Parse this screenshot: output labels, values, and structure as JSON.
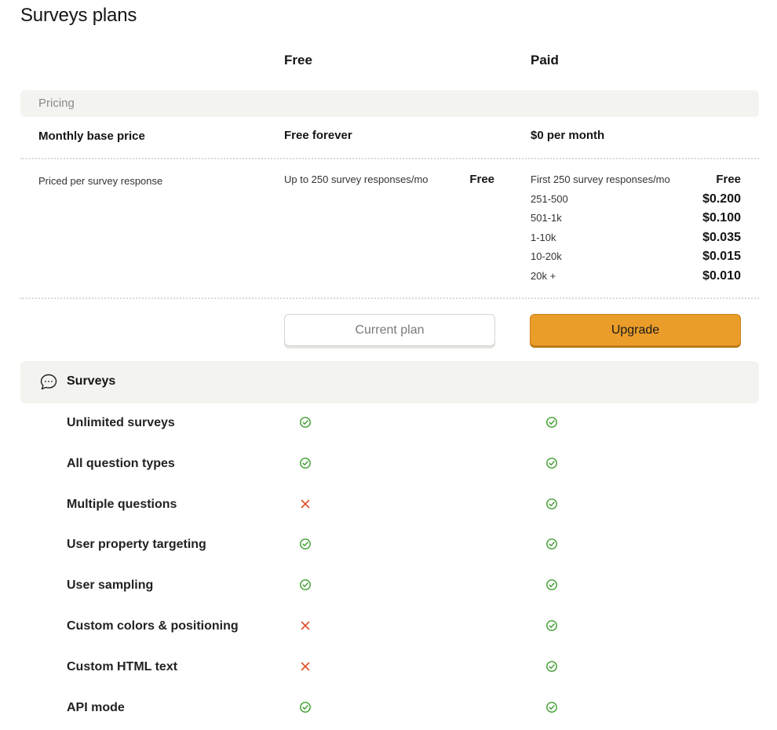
{
  "page": {
    "title": "Surveys plans"
  },
  "plans": {
    "free": "Free",
    "paid": "Paid"
  },
  "pricing": {
    "section_label": "Pricing",
    "base_label": "Monthly base price",
    "base_free": "Free forever",
    "base_paid": "$0 per month",
    "per_label": "Priced per survey response",
    "free_tier": {
      "name": "Up to 250 survey responses/mo",
      "price": "Free"
    },
    "paid_tiers": [
      {
        "name": "First 250 survey responses/mo",
        "price": "Free"
      },
      {
        "name": "251-500",
        "price": "$0.200"
      },
      {
        "name": "501-1k",
        "price": "$0.100"
      },
      {
        "name": "1-10k",
        "price": "$0.035"
      },
      {
        "name": "10-20k",
        "price": "$0.015"
      },
      {
        "name": "20k +",
        "price": "$0.010"
      }
    ]
  },
  "buttons": {
    "current": "Current plan",
    "upgrade": "Upgrade"
  },
  "surveys": {
    "section_label": "Surveys",
    "icon": "chat-bubble-icon",
    "features": [
      {
        "label": "Unlimited surveys",
        "free": true,
        "paid": true
      },
      {
        "label": "All question types",
        "free": true,
        "paid": true
      },
      {
        "label": "Multiple questions",
        "free": false,
        "paid": true
      },
      {
        "label": "User property targeting",
        "free": true,
        "paid": true
      },
      {
        "label": "User sampling",
        "free": true,
        "paid": true
      },
      {
        "label": "Custom colors & positioning",
        "free": false,
        "paid": true
      },
      {
        "label": "Custom HTML text",
        "free": false,
        "paid": true
      },
      {
        "label": "API mode",
        "free": true,
        "paid": true
      }
    ]
  },
  "colors": {
    "check": "#3a9c2a",
    "cross": "#e0502a",
    "upgrade": "#eb9d2a",
    "section_bg": "#f3f3ef"
  }
}
